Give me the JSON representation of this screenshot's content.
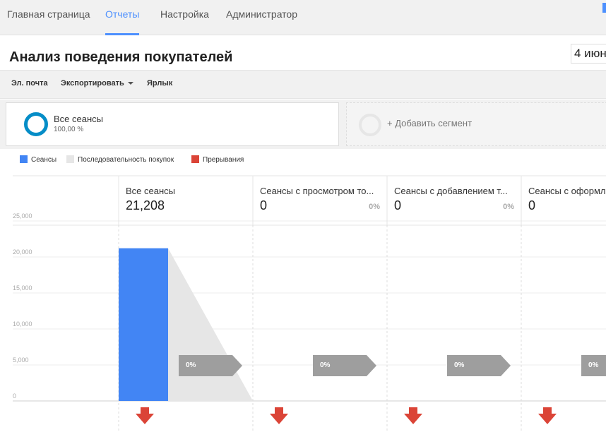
{
  "nav": {
    "tabs": [
      {
        "label": "Главная страница",
        "active": false
      },
      {
        "label": "Отчеты",
        "active": true
      },
      {
        "label": "Настройка",
        "active": false
      },
      {
        "label": "Администратор",
        "active": false
      }
    ]
  },
  "header": {
    "title": "Анализ поведения покупателей",
    "date": "4 июн"
  },
  "toolbar": {
    "email": "Эл. почта",
    "export": "Экспортировать",
    "shortcut": "Ярлык"
  },
  "segments": {
    "active_name": "Все сеансы",
    "active_pct": "100,00 %",
    "add_label": "+ Добавить сегмент"
  },
  "legend": [
    {
      "label": "Сеансы",
      "color": "#4285f4"
    },
    {
      "label": "Последовательность покупок",
      "color": "#e6e6e6"
    },
    {
      "label": "Прерывания",
      "color": "#db4437"
    }
  ],
  "colors": {
    "accent": "#4d90fe",
    "sessions_bar": "#4285f4",
    "funnel": "#e6e6e6",
    "abandon": "#db4437",
    "ring": "#058dc7",
    "arrow_gray": "#9e9e9e"
  },
  "chart_data": {
    "type": "bar",
    "categories": [
      "Все сеансы",
      "Сеансы с просмотром то...",
      "Сеансы с добавлением т...",
      "Сеансы с оформл"
    ],
    "values": [
      21208,
      0,
      0,
      0
    ],
    "display_values": [
      "21,208",
      "0",
      "0",
      "0"
    ],
    "column_pcts": [
      "",
      "0%",
      "0%",
      ""
    ],
    "transition_pcts": [
      "0%",
      "0%",
      "0%",
      "0%"
    ],
    "yticks": [
      "25,000",
      "20,000",
      "15,000",
      "10,000",
      "5,000",
      "0"
    ],
    "ylim": [
      0,
      25000
    ],
    "grid": true
  }
}
